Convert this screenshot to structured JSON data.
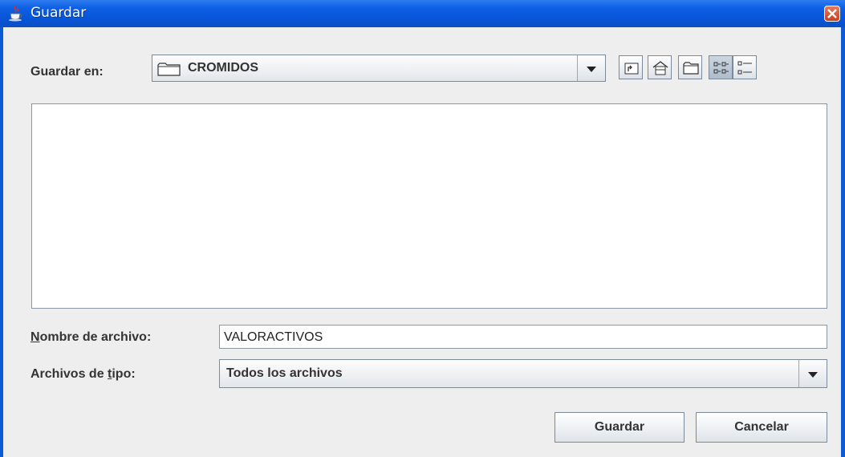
{
  "window": {
    "title": "Guardar"
  },
  "toolbar": {
    "save_in_label": "Guardar en:",
    "current_folder": "CROMIDOS",
    "buttons": [
      "up-one-level",
      "home",
      "new-folder",
      "list-view",
      "details-view"
    ]
  },
  "file_name": {
    "label_first": "N",
    "label_rest": "ombre de archivo:",
    "value": "VALORACTIVOS"
  },
  "file_type": {
    "label_before": "Archivos de ",
    "label_underlined": "t",
    "label_after": "ipo:",
    "selected": "Todos los archivos"
  },
  "actions": {
    "save_label": "Guardar",
    "cancel_label": "Cancelar"
  },
  "colors": {
    "titlebar": "#0b5ad8",
    "background": "#eeeeee",
    "close": "#d0502e"
  }
}
